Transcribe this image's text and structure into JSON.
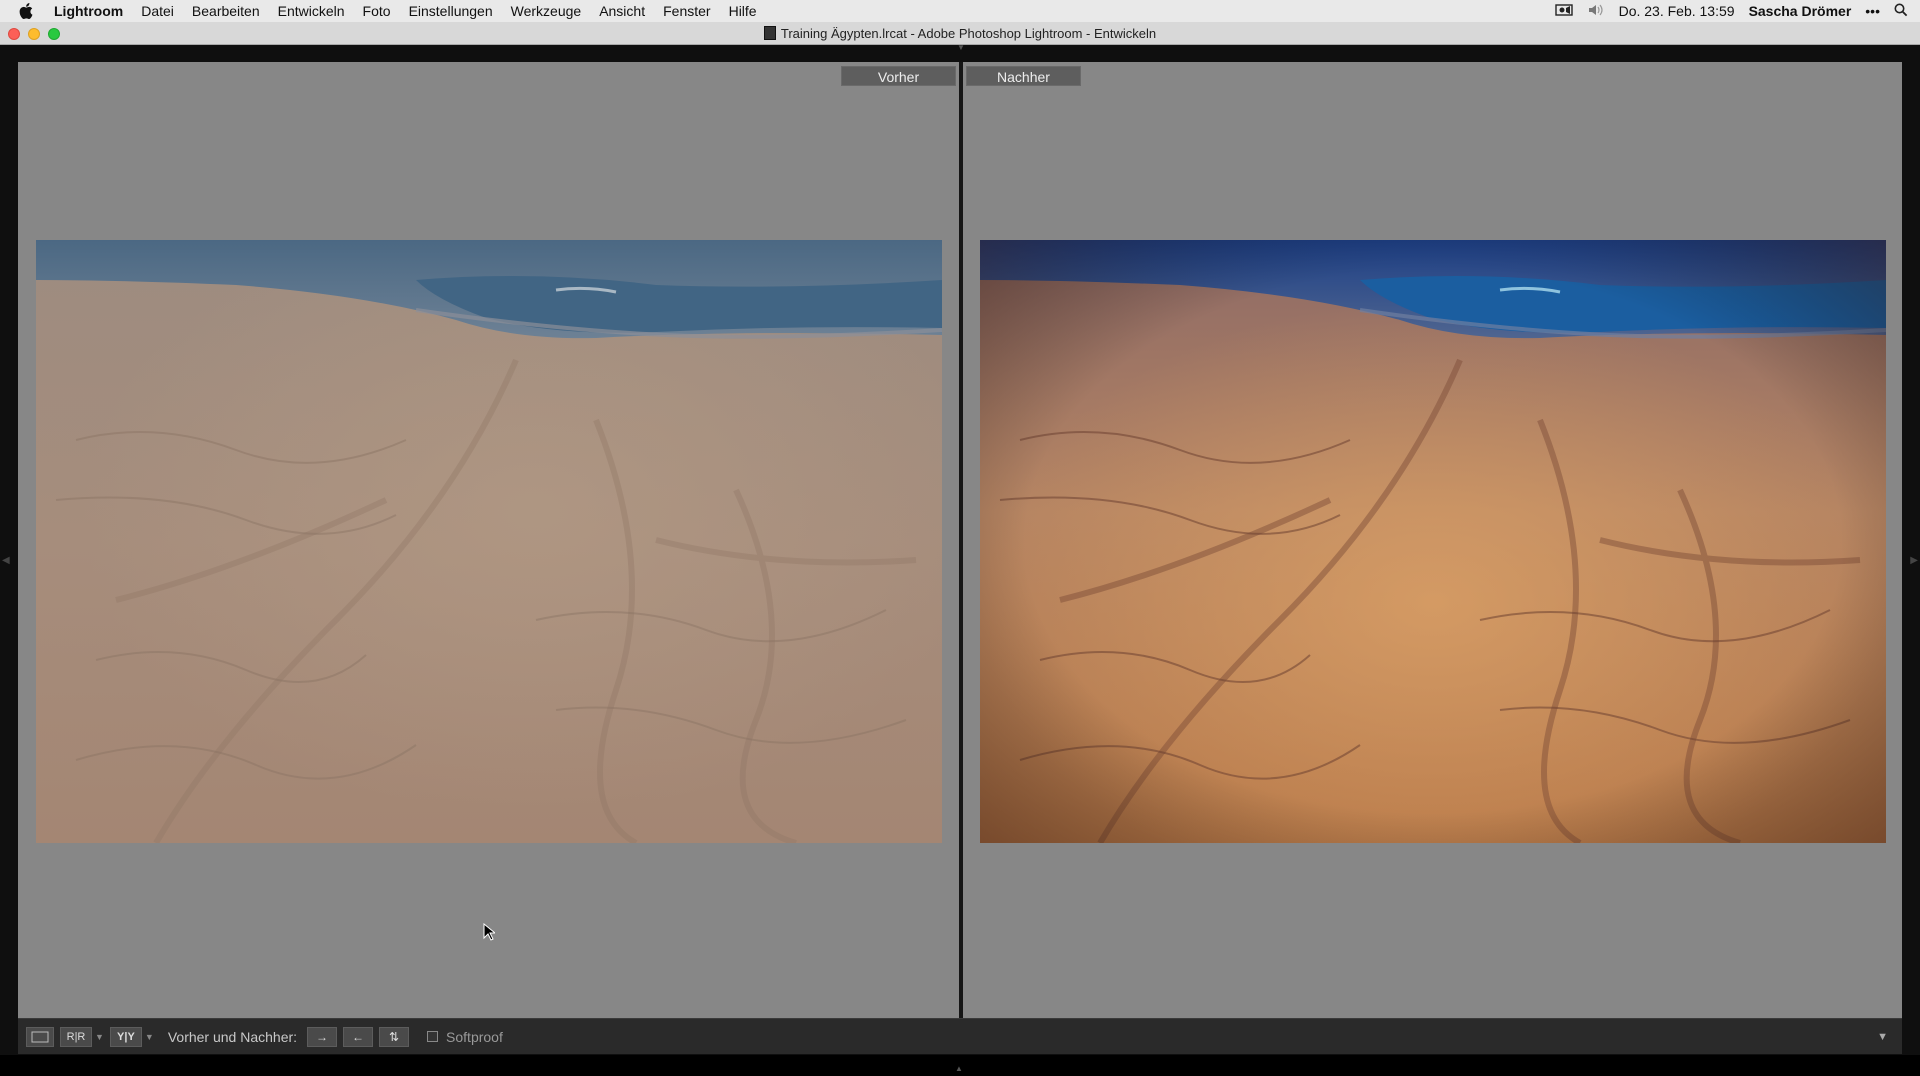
{
  "menubar": {
    "app_name": "Lightroom",
    "items": [
      "Datei",
      "Bearbeiten",
      "Entwickeln",
      "Foto",
      "Einstellungen",
      "Werkzeuge",
      "Ansicht",
      "Fenster",
      "Hilfe"
    ],
    "datetime": "Do. 23. Feb.  13:59",
    "user": "Sascha Drömer",
    "more": "•••"
  },
  "window": {
    "title": "Training Ägypten.lrcat - Adobe Photoshop Lightroom - Entwickeln"
  },
  "compare": {
    "before_label": "Vorher",
    "after_label": "Nachher"
  },
  "toolbar": {
    "view_yy": "Y|Y",
    "view_ref": "R|R",
    "before_after_label": "Vorher und Nachher:",
    "copy_before_to_after": "→",
    "copy_after_to_before": "←",
    "swap": "⇅",
    "softproof_label": "Softproof",
    "softproof_checked": false,
    "menu_caret": "▼"
  },
  "colors": {
    "pane_background": "#878787",
    "toolbar_background": "#2a2a2a",
    "sea_before": "#3f6582",
    "sea_after": "#1c5b99",
    "sand_before": "#a48c7c",
    "sand_after": "#c88a5a"
  }
}
